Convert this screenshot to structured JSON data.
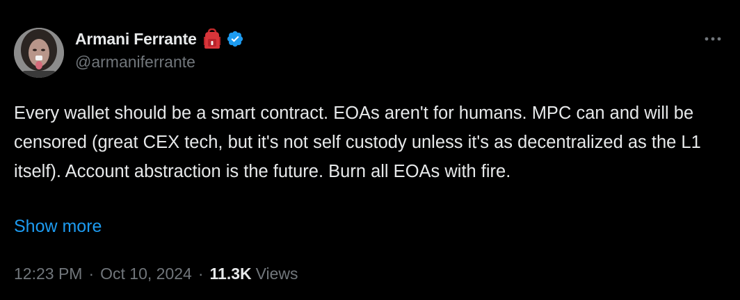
{
  "author": {
    "display_name": "Armani Ferrante",
    "handle": "@armaniferrante",
    "emoji_icon": "red-backpack-emoji",
    "verified_icon": "verified-badge-icon",
    "verified_color": "#1d9bf0"
  },
  "tweet": {
    "text": "Every wallet should be a smart contract. EOAs aren't for humans. MPC can and will be censored (great CEX tech, but it's not self custody unless it's as decentralized as the L1 itself). Account abstraction is the future. Burn all EOAs with fire.",
    "show_more_label": "Show more"
  },
  "meta": {
    "time": "12:23 PM",
    "separator": "·",
    "date": "Oct 10, 2024",
    "views_count": "11.3K",
    "views_label": "Views"
  },
  "more_icon": "more-horizontal-icon",
  "colors": {
    "background": "#000000",
    "text_primary": "#e7e9ea",
    "text_secondary": "#71767b",
    "link": "#1d9bf0"
  }
}
